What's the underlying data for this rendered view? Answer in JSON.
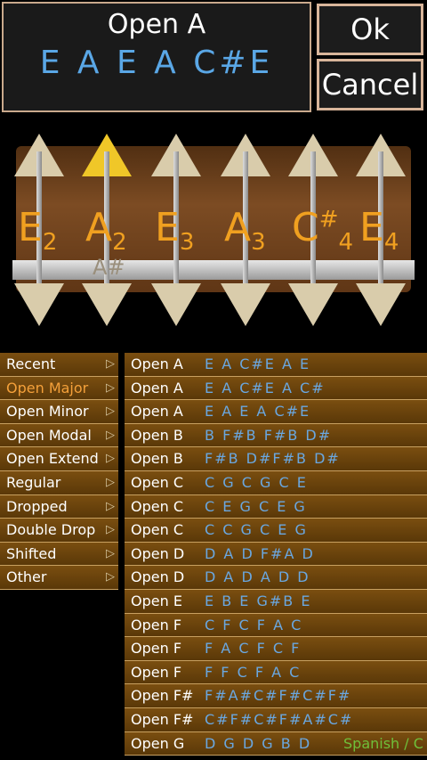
{
  "header": {
    "title": "Open A",
    "notes": "E A E A C#E"
  },
  "buttons": {
    "ok": "Ok",
    "cancel": "Cancel"
  },
  "strings": [
    {
      "note": "E",
      "octave": "2",
      "sharp": ""
    },
    {
      "note": "A",
      "octave": "2",
      "sharp": ""
    },
    {
      "note": "E",
      "octave": "3",
      "sharp": ""
    },
    {
      "note": "A",
      "octave": "3",
      "sharp": ""
    },
    {
      "note": "C",
      "octave": "4",
      "sharp": "#"
    },
    {
      "note": "E",
      "octave": "4",
      "sharp": ""
    }
  ],
  "shadow_label": "A#",
  "categories": [
    {
      "label": "Recent"
    },
    {
      "label": "Open Major"
    },
    {
      "label": "Open Minor"
    },
    {
      "label": "Open Modal"
    },
    {
      "label": "Open Extend"
    },
    {
      "label": "Regular"
    },
    {
      "label": "Dropped"
    },
    {
      "label": "Double Drop"
    },
    {
      "label": "Shifted"
    },
    {
      "label": "Other"
    }
  ],
  "chevron": "▷",
  "tunings": [
    {
      "name": "Open A",
      "notes": "E A C#E A E"
    },
    {
      "name": "Open A",
      "notes": "E A C#E A C#"
    },
    {
      "name": "Open A",
      "notes": "E A E A C#E"
    },
    {
      "name": "Open B",
      "notes": "B F#B F#B D#"
    },
    {
      "name": "Open B",
      "notes": "F#B D#F#B D#"
    },
    {
      "name": "Open C",
      "notes": "C G C G C E"
    },
    {
      "name": "Open C",
      "notes": "C E G C E G"
    },
    {
      "name": "Open C",
      "notes": "C C G C E G"
    },
    {
      "name": "Open D",
      "notes": "D A D F#A D"
    },
    {
      "name": "Open D",
      "notes": "D A D A D D"
    },
    {
      "name": "Open E",
      "notes": "E B E G#B E"
    },
    {
      "name": "Open F",
      "notes": "C F C F A C"
    },
    {
      "name": "Open F",
      "notes": "F A C F C F"
    },
    {
      "name": "Open F",
      "notes": "F F C F A C"
    },
    {
      "name": "Open F#",
      "notes": "F#A#C#F#C#F#"
    },
    {
      "name": "Open F#",
      "notes": "C#F#C#F#A#C#"
    },
    {
      "name": "Open G",
      "notes": "D G D G B D",
      "tag": "Spanish / C"
    }
  ],
  "colors": {
    "accent": "#f0a020",
    "blue": "#5aa7e6",
    "green": "#6fbf3a"
  }
}
